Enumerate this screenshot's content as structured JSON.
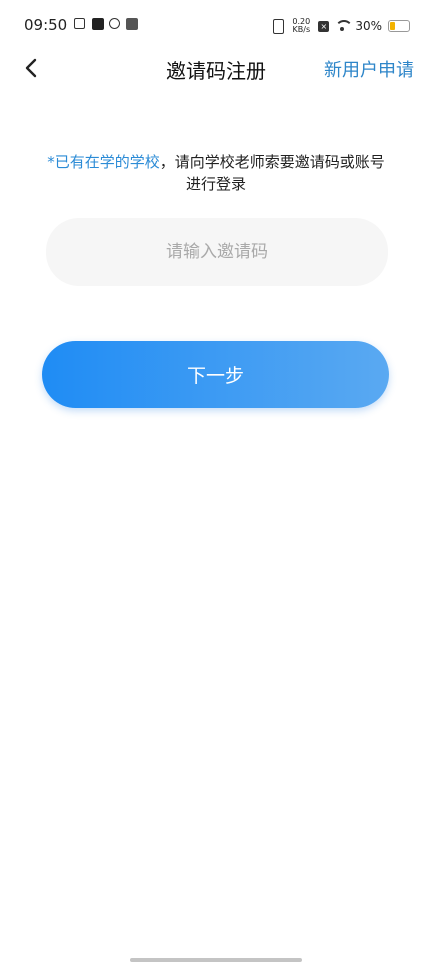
{
  "status_bar": {
    "time": "09:50",
    "net_speed_value": "0.20",
    "net_speed_unit": "KB/s",
    "battery_text": "30%",
    "battery_level": 0.3,
    "battery_color": "#f2b200"
  },
  "header": {
    "title": "邀请码注册",
    "new_user_link": "新用户申请"
  },
  "notice": {
    "highlight": "*已有在学的学校",
    "text": "，请向学校老师索要邀请码或账号进行登录"
  },
  "invite_input": {
    "value": "",
    "placeholder": "请输入邀请码"
  },
  "next_button": {
    "label": "下一步"
  },
  "colors": {
    "accent": "#2b8bd6",
    "button_start": "#1f8cf4",
    "button_end": "#5aa9f2"
  }
}
